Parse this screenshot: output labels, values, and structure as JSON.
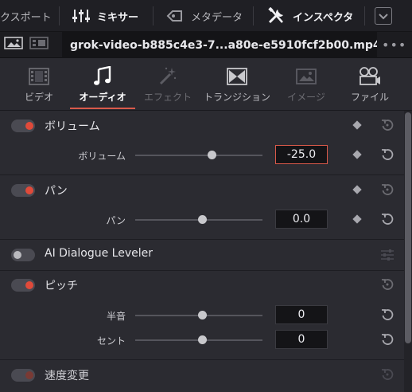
{
  "toolbar": {
    "export_label": "クスポート",
    "mixer_label": "ミキサー",
    "metadata_label": "メタデータ",
    "inspector_label": "インスペクタ"
  },
  "file": {
    "name": "grok-video-b885c4e3-7...a80e-e5910fcf2b00.mp4",
    "more": "•••"
  },
  "tabs": [
    {
      "label": "ビデオ",
      "icon": "film-icon",
      "state": "normal"
    },
    {
      "label": "オーディオ",
      "icon": "music-note-icon",
      "state": "active"
    },
    {
      "label": "エフェクト",
      "icon": "magic-wand-icon",
      "state": "disabled"
    },
    {
      "label": "トランジション",
      "icon": "transition-icon",
      "state": "normal"
    },
    {
      "label": "イメージ",
      "icon": "image-icon",
      "state": "disabled"
    },
    {
      "label": "ファイル",
      "icon": "film-reel-icon",
      "state": "normal"
    }
  ],
  "sections": {
    "volume": {
      "title": "ボリューム",
      "enabled": true,
      "param_label": "ボリューム",
      "value": "-25.0",
      "slider_fraction": 0.6
    },
    "pan": {
      "title": "パン",
      "enabled": true,
      "param_label": "パン",
      "value": "0.0",
      "slider_fraction": 0.5
    },
    "dialogue": {
      "title": "AI Dialogue Leveler",
      "enabled": false
    },
    "pitch": {
      "title": "ピッチ",
      "enabled": true,
      "semitone_label": "半音",
      "semitone_value": "0",
      "semitone_fraction": 0.5,
      "cent_label": "セント",
      "cent_value": "0",
      "cent_fraction": 0.5
    },
    "speed": {
      "title": "速度変更",
      "enabled": true
    }
  },
  "colors": {
    "accent": "#d95a4a",
    "toggle_on": "#e04a3a",
    "background": "#2b2b31"
  }
}
